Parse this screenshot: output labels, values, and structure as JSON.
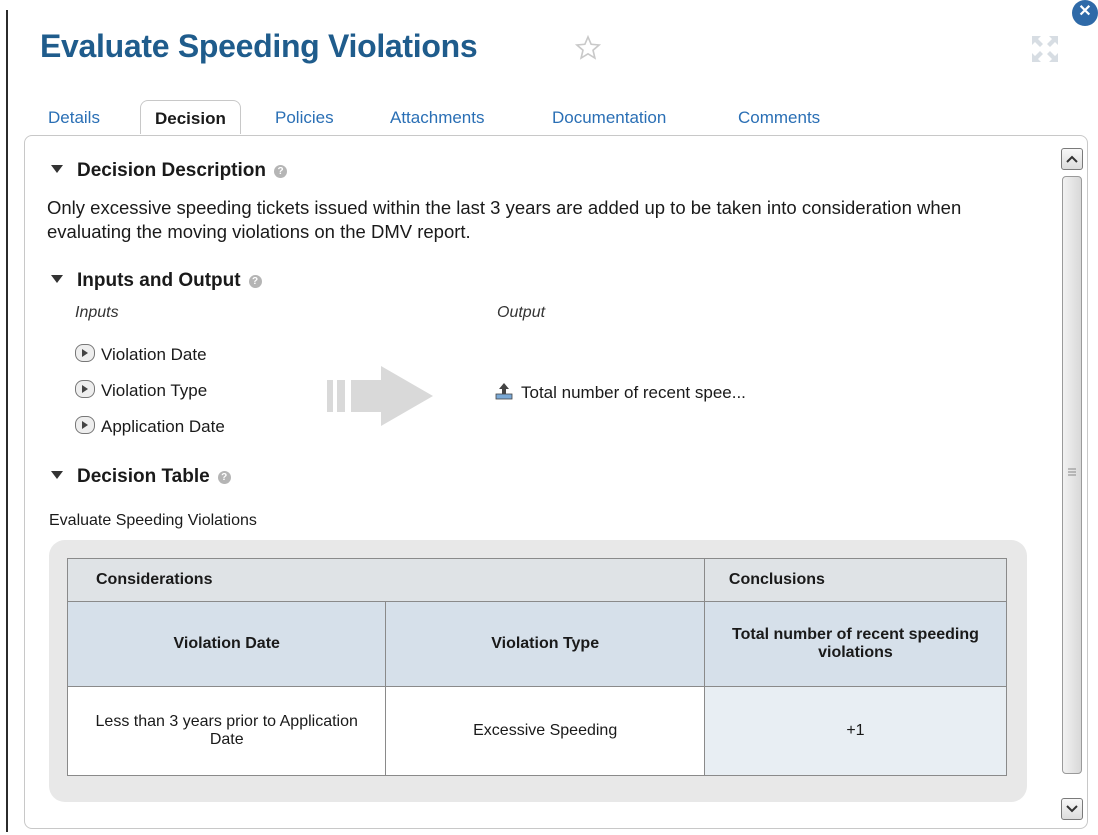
{
  "header": {
    "title": "Evaluate Speeding Violations"
  },
  "tabs": [
    "Details",
    "Decision",
    "Policies",
    "Attachments",
    "Documentation",
    "Comments"
  ],
  "sections": {
    "description": {
      "title": "Decision Description",
      "text": "Only excessive speeding tickets issued within the last 3 years are added up to be taken into consideration when evaluating the moving violations on the DMV report."
    },
    "io": {
      "title": "Inputs and Output",
      "inputs_label": "Inputs",
      "output_label": "Output",
      "inputs": [
        "Violation Date",
        "Violation Type",
        "Application Date"
      ],
      "output": "Total number of recent spee..."
    },
    "table": {
      "title": "Decision Table",
      "name": "Evaluate Speeding Violations",
      "considerations": "Considerations",
      "conclusions": "Conclusions",
      "col1": "Violation Date",
      "col2": "Violation Type",
      "col3": "Total number of recent speeding violations",
      "row1": [
        "Less than 3 years prior to Application Date",
        "Excessive Speeding",
        "+1"
      ]
    }
  },
  "icons": [
    "star-icon",
    "maximize-icon",
    "close-icon",
    "help-icon",
    "input-arrow-icon",
    "output-upload-icon",
    "flow-arrow-icon"
  ]
}
